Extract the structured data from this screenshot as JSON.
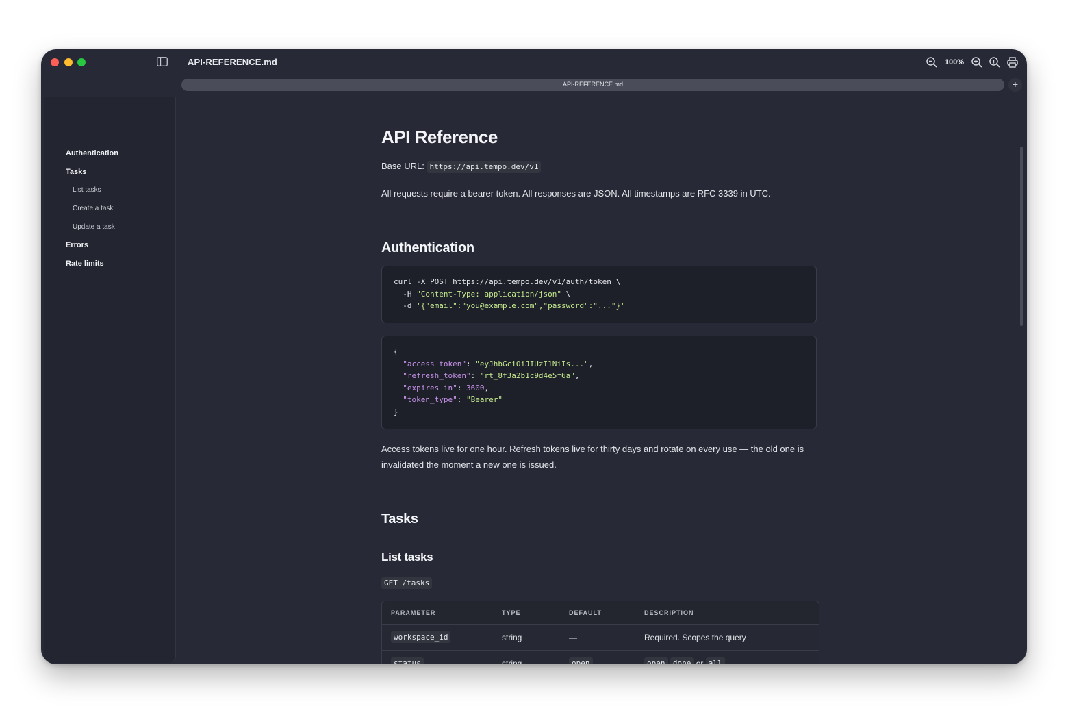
{
  "window": {
    "title": "API-REFERENCE.md",
    "zoom": "100%",
    "tab": {
      "label": "API-REFERENCE.md",
      "add_label": "+"
    }
  },
  "sidebar": {
    "items": [
      {
        "label": "Authentication",
        "level": 1
      },
      {
        "label": "Tasks",
        "level": 1
      },
      {
        "label": "List tasks",
        "level": 2
      },
      {
        "label": "Create a task",
        "level": 2
      },
      {
        "label": "Update a task",
        "level": 2
      },
      {
        "label": "Errors",
        "level": 1
      },
      {
        "label": "Rate limits",
        "level": 1
      }
    ]
  },
  "doc": {
    "title": "API Reference",
    "base_url_label": "Base URL:",
    "base_url": "https://api.tempo.dev/v1",
    "intro": "All requests require a bearer token. All responses are JSON. All timestamps are RFC 3339 in UTC.",
    "auth": {
      "heading": "Authentication",
      "request_lines": [
        "curl -X POST https://api.tempo.dev/v1/auth/token \\",
        "  -H \"Content-Type: application/json\" \\",
        "  -d '{\"email\":\"you@example.com\",\"password\":\"...\"}'"
      ],
      "response": {
        "open": "{",
        "fields": [
          {
            "key": "\"access_token\"",
            "value": "\"eyJhbGciOiJIUzI1NiIs...\"",
            "type": "string"
          },
          {
            "key": "\"refresh_token\"",
            "value": "\"rt_8f3a2b1c9d4e5f6a\"",
            "type": "string"
          },
          {
            "key": "\"expires_in\"",
            "value": "3600",
            "type": "number"
          },
          {
            "key": "\"token_type\"",
            "value": "\"Bearer\"",
            "type": "string"
          }
        ],
        "close": "}"
      },
      "note_line1": "Access tokens live for one hour. Refresh tokens live for thirty days and rotate on every use — the old one is",
      "note_line2": "invalidated the moment a new one is issued."
    },
    "tasks": {
      "heading": "Tasks",
      "list": {
        "heading": "List tasks",
        "endpoint": "GET /tasks",
        "table": {
          "headers": [
            "PARAMETER",
            "TYPE",
            "DEFAULT",
            "DESCRIPTION"
          ],
          "rows": [
            {
              "parameter": "workspace_id",
              "type": "string",
              "default": "—",
              "description": "Required. Scopes the query"
            },
            {
              "parameter": "status",
              "type": "string",
              "default": "open",
              "description_parts": [
                "open",
                "done",
                "or",
                "all"
              ]
            }
          ]
        }
      }
    }
  },
  "colors": {
    "background": "#272a36",
    "sidebar": "#232530",
    "code_bg": "#1e2029",
    "string": "#c3e88d",
    "key": "#c792ea"
  }
}
